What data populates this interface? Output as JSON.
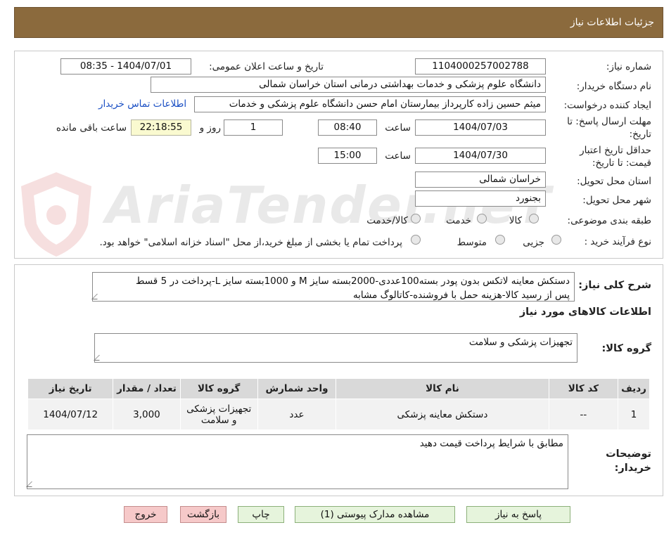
{
  "header": {
    "title": "جزئيات اطلاعات نياز"
  },
  "form": {
    "need_number_label": "شماره نیاز:",
    "need_number": "1104000257002788",
    "announce_label": "تاریخ و ساعت اعلان عمومی:",
    "announce_value": "1404/07/01 - 08:35",
    "buyer_org_label": "نام دستگاه خریدار:",
    "buyer_org": "دانشگاه علوم پزشکی و خدمات بهداشتی درمانی استان خراسان شمالی",
    "creator_label": "ایجاد کننده درخواست:",
    "creator": "میثم  حسین زاده  کارپرداز بیمارستان امام حسن دانشگاه علوم پزشکی و خدمات",
    "contact_link": "اطلاعات تماس خریدار",
    "deadline_label_1": "مهلت ارسال پاسخ: تا",
    "deadline_label_2": "تاریخ:",
    "deadline_date": "1404/07/03",
    "time_label": "ساعت",
    "deadline_time": "08:40",
    "days_value": "1",
    "days_label": "روز و",
    "remaining_time": "22:18:55",
    "remaining_label": "ساعت باقی مانده",
    "validity_label_1": "حداقل تاریخ اعتبار",
    "validity_label_2": "قیمت: تا تاریخ:",
    "validity_date": "1404/07/30",
    "validity_time": "15:00",
    "province_label": "استان محل تحویل:",
    "province": "خراسان شمالی",
    "city_label": "شهر محل تحویل:",
    "city": "بجنورد",
    "category_label": "طبقه بندی موضوعی:",
    "category_options": [
      "کالا",
      "خدمت",
      "کالا/خدمت"
    ],
    "process_label": "نوع فرآیند خرید :",
    "process_options": [
      "جزیی",
      "متوسط"
    ],
    "process_note": "پرداخت تمام یا بخشی از مبلغ خرید،از محل \"اسناد خزانه اسلامی\" خواهد بود."
  },
  "description": {
    "label": "شرح کلی نیاز:",
    "text_line1": "دستکش معاینه لاتکس بدون پودر بسته100عددی-2000بسته سایز M و 1000بسته سایز L-پرداخت در 5 قسط",
    "text_line2": "پس از رسید کالا-هزینه حمل با فروشنده-کاتالوگ مشابه"
  },
  "goods": {
    "section_title": "اطلاعات کالاهای مورد نیاز",
    "group_label": "گروه کالا:",
    "group_value": "تجهیزات پزشکی و سلامت",
    "columns": [
      "ردیف",
      "کد کالا",
      "نام کالا",
      "واحد شمارش",
      "گروه کالا",
      "تعداد / مقدار",
      "تاریخ نیاز"
    ],
    "rows": [
      [
        "1",
        "--",
        "دستکش معاینه پزشکی",
        "عدد",
        "تجهیزات پزشکی و سلامت",
        "3,000",
        "1404/07/12"
      ]
    ]
  },
  "buyer_notes": {
    "label_1": "توضیحات",
    "label_2": "خریدار:",
    "text": "مطابق با شرایط پرداخت قیمت دهید"
  },
  "buttons": {
    "reply": "پاسخ به نیاز",
    "attachments": "مشاهده مدارک پیوستی (1)",
    "print": "چاپ",
    "back": "بازگشت",
    "exit": "خروج"
  },
  "watermark": {
    "text": "AriaTender.neT"
  },
  "colors": {
    "header_bg": "#8b6a3d",
    "link": "#1a4fc4",
    "reply_btn": "#e6f4dc",
    "exit_btn": "#f6c9c9"
  }
}
